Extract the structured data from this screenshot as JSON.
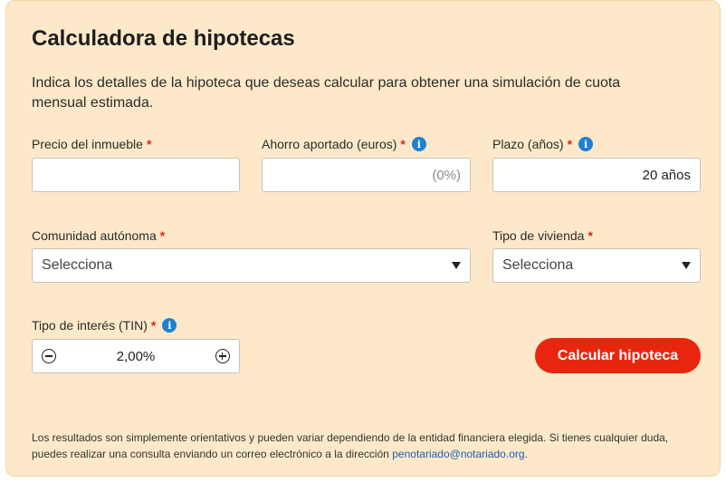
{
  "calculator": {
    "title": "Calculadora de hipotecas",
    "intro": "Indica los detalles de la hipoteca que deseas calcular para obtener una simulación de cuota mensual estimada.",
    "required_mark": "*",
    "fields": {
      "price": {
        "label": "Precio del inmueble",
        "value": "",
        "placeholder": ""
      },
      "savings": {
        "label": "Ahorro aportado (euros)",
        "value": "",
        "placeholder": "(0%)",
        "has_info": true
      },
      "term": {
        "label": "Plazo (años)",
        "value": "20 años",
        "placeholder": "",
        "has_info": true
      },
      "region": {
        "label": "Comunidad autónoma",
        "selected": "Selecciona"
      },
      "housing_type": {
        "label": "Tipo de vivienda",
        "selected": "Selecciona"
      },
      "interest": {
        "label": "Tipo de interés (TIN)",
        "value": "2,00%",
        "has_info": true
      }
    },
    "submit_label": "Calcular hipoteca",
    "disclaimer_text": "Los resultados son simplemente orientativos y pueden variar dependiendo de la entidad financiera elegida. Si tienes cualquier duda, puedes realizar una consulta enviando un correo electrónico a la dirección ",
    "disclaimer_email": "penotariado@notariado.org",
    "disclaimer_end": "."
  },
  "icons": {
    "info": "info-icon",
    "decrement": "minus-circle-icon",
    "increment": "plus-circle-icon",
    "dropdown": "caret-down-icon"
  },
  "colors": {
    "card_bg": "#fde9c9",
    "accent": "#e8260f",
    "required": "#d9261c",
    "info": "#1f7fd1",
    "link": "#1f5fb0"
  }
}
